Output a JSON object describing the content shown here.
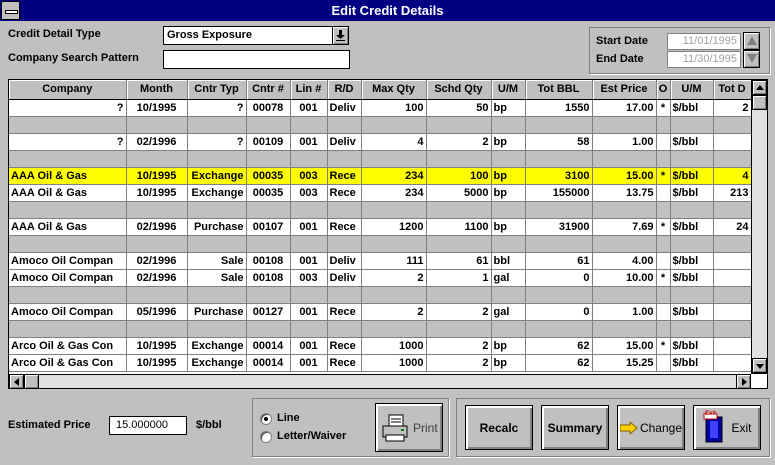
{
  "window": {
    "title": "Edit Credit Details"
  },
  "filters": {
    "credit_detail_type_label": "Credit Detail Type",
    "credit_detail_type_value": "Gross Exposure",
    "company_search_label": "Company Search Pattern",
    "company_search_value": "",
    "start_date_label": "Start Date",
    "start_date_value": "11/01/1995",
    "end_date_label": "End Date",
    "end_date_value": "11/30/1995"
  },
  "grid": {
    "columns": [
      "Company",
      "Month",
      "Cntr Typ",
      "Cntr #",
      "Lin #",
      "R/D",
      "Max Qty",
      "Schd Qty",
      "U/M",
      "Tot BBL",
      "Est Price",
      "O",
      "U/M",
      "Tot D"
    ],
    "rows": [
      {
        "sep": false,
        "cells": [
          "?",
          "10/1995",
          "?",
          "00078",
          "001",
          "Deliv",
          "100",
          "50",
          "bp",
          "1550",
          "17.00",
          "*",
          "$/bbl",
          "2"
        ]
      },
      {
        "sep": true
      },
      {
        "sep": false,
        "cells": [
          "?",
          "02/1996",
          "?",
          "00109",
          "001",
          "Deliv",
          "4",
          "2",
          "bp",
          "58",
          "1.00",
          "",
          "$/bbl",
          ""
        ]
      },
      {
        "sep": true
      },
      {
        "sep": false,
        "selected": true,
        "cells": [
          "AAA Oil & Gas",
          "10/1995",
          "Exchange",
          "00035",
          "003",
          "Rece",
          "234",
          "100",
          "bp",
          "3100",
          "15.00",
          "*",
          "$/bbl",
          "4"
        ]
      },
      {
        "sep": false,
        "cells": [
          "AAA Oil & Gas",
          "10/1995",
          "Exchange",
          "00035",
          "003",
          "Rece",
          "234",
          "5000",
          "bp",
          "155000",
          "13.75",
          "",
          "$/bbl",
          "213"
        ]
      },
      {
        "sep": true
      },
      {
        "sep": false,
        "cells": [
          "AAA Oil & Gas",
          "02/1996",
          "Purchase",
          "00107",
          "001",
          "Rece",
          "1200",
          "1100",
          "bp",
          "31900",
          "7.69",
          "*",
          "$/bbl",
          "24"
        ]
      },
      {
        "sep": true
      },
      {
        "sep": false,
        "cells": [
          "Amoco Oil Compan",
          "02/1996",
          "Sale",
          "00108",
          "001",
          "Deliv",
          "111",
          "61",
          "bbl",
          "61",
          "4.00",
          "",
          "$/bbl",
          ""
        ]
      },
      {
        "sep": false,
        "cells": [
          "Amoco Oil Compan",
          "02/1996",
          "Sale",
          "00108",
          "003",
          "Deliv",
          "2",
          "1",
          "gal",
          "0",
          "10.00",
          "*",
          "$/bbl",
          ""
        ]
      },
      {
        "sep": true
      },
      {
        "sep": false,
        "cells": [
          "Amoco Oil Compan",
          "05/1996",
          "Purchase",
          "00127",
          "001",
          "Rece",
          "2",
          "2",
          "gal",
          "0",
          "1.00",
          "",
          "$/bbl",
          ""
        ]
      },
      {
        "sep": true
      },
      {
        "sep": false,
        "cells": [
          "Arco Oil & Gas Con",
          "10/1995",
          "Exchange",
          "00014",
          "001",
          "Rece",
          "1000",
          "2",
          "bp",
          "62",
          "15.00",
          "*",
          "$/bbl",
          ""
        ]
      },
      {
        "sep": false,
        "cells": [
          "Arco Oil & Gas Con",
          "10/1995",
          "Exchange",
          "00014",
          "001",
          "Rece",
          "1000",
          "2",
          "bp",
          "62",
          "15.25",
          "",
          "$/bbl",
          ""
        ]
      }
    ]
  },
  "footer": {
    "estimated_price_label": "Estimated Price",
    "estimated_price_value": "15.000000",
    "estimated_price_unit": "$/bbl",
    "radio_line": "Line",
    "radio_letter": "Letter/Waiver",
    "radio_selected": "line",
    "print_label": "Print",
    "recalc_label": "Recalc",
    "summary_label": "Summary",
    "change_label": "Change",
    "exit_label": "Exit",
    "exit_icon_text": "Exit"
  },
  "colors": {
    "titlebar": "#000080",
    "selected_row": "#ffff00",
    "background": "#c0c0c0"
  }
}
